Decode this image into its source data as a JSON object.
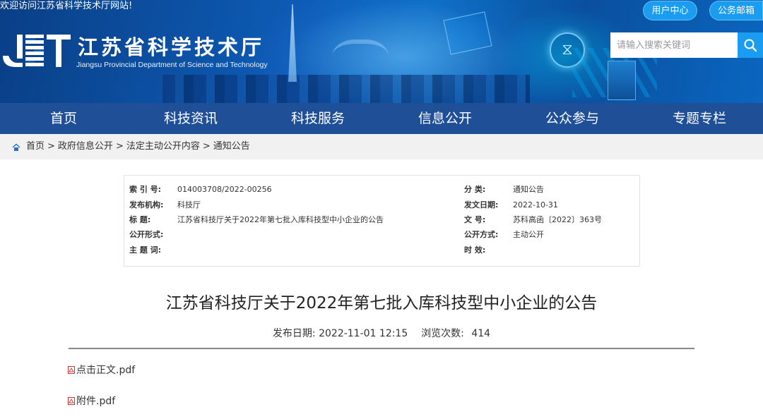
{
  "header": {
    "welcome": "欢迎访问江苏省科学技术厅网站!",
    "site_name": "江苏省科学技术厅",
    "site_sub": "Jiangsu Provincial Department of Science and Technology",
    "user_center": "用户中心",
    "mail": "公务邮箱",
    "search_placeholder": "请输入搜索关键词"
  },
  "nav": {
    "items": [
      "首页",
      "科技资讯",
      "科技服务",
      "信息公开",
      "公众参与",
      "专题专栏"
    ]
  },
  "breadcrumb": {
    "items": [
      "首页",
      "政府信息公开",
      "法定主动公开内容",
      "通知公告"
    ],
    "sep": ">"
  },
  "meta": {
    "index_label": "索 引 号:",
    "index_value": "014003708/2022-00256",
    "org_label": "发布机构:",
    "org_value": "科技厅",
    "title_label": "标 题:",
    "title_value": "江苏省科技厅关于2022年第七批入库科技型中小企业的公告",
    "form_label": "公开形式:",
    "form_value": "",
    "subject_label": "主 题 词:",
    "subject_value": "",
    "category_label": "分 类:",
    "category_value": "通知公告",
    "date_label": "发文日期:",
    "date_value": "2022-10-31",
    "doc_label": "文 号:",
    "doc_value": "苏科高函〔2022〕363号",
    "mode_label": "公开方式:",
    "mode_value": "主动公开",
    "valid_label": "时 效:",
    "valid_value": ""
  },
  "article": {
    "title": "江苏省科技厅关于2022年第七批入库科技型中小企业的公告",
    "publish_label": "发布日期:",
    "publish_value": "2022-11-01 12:15",
    "views_label": "浏览次数:",
    "views_value": "414",
    "attachments": [
      "点击正文.pdf",
      "附件.pdf"
    ]
  },
  "colors": {
    "nav_bg": "#1f4f96",
    "accent": "#1a9cf0"
  }
}
